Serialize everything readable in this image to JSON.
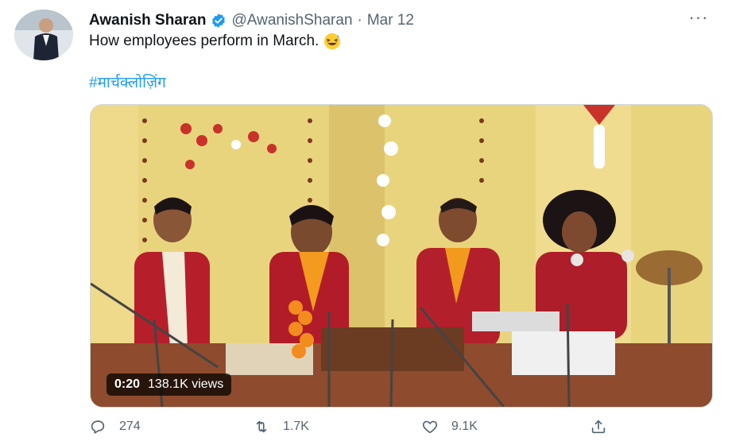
{
  "tweet": {
    "author_name": "Awanish Sharan",
    "handle": "@AwanishSharan",
    "separator": "·",
    "date": "Mar 12",
    "text": "How employees perform in March.",
    "emoji": "grinning-squinting-sweat-face",
    "hashtag": "#मार्चक्लोज़िंग",
    "more_label": "···"
  },
  "media": {
    "timestamp": "0:20",
    "views": "138.1K views"
  },
  "actions": {
    "reply_count": "274",
    "retweet_count": "1.7K",
    "like_count": "9.1K"
  },
  "icons": {
    "verified": "verified-badge-icon",
    "reply": "reply-icon",
    "retweet": "retweet-icon",
    "like": "heart-icon",
    "share": "share-icon"
  },
  "colors": {
    "accent": "#1d9bf0",
    "secondary_text": "#536471",
    "background": "#ffffff"
  }
}
